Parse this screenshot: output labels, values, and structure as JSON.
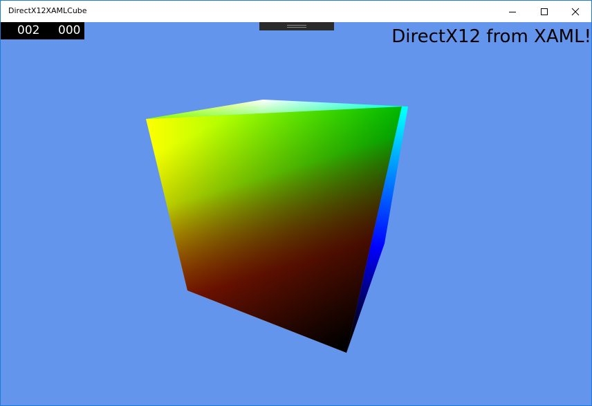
{
  "window": {
    "title": "DirectX12XAMLCube"
  },
  "caption_buttons": {
    "minimize_icon": "minimize-icon",
    "maximize_icon": "maximize-icon",
    "close_icon": "close-icon"
  },
  "content": {
    "background_color": "#6495ed",
    "counter": {
      "left_value": "002",
      "right_value": "000"
    },
    "headline": "DirectX12 from XAML!",
    "cube_colors": {
      "top": [
        "#ffff00",
        "#ffffff",
        "#00ffff",
        "#00ff00"
      ],
      "front": [
        "#ffff00",
        "#00ff00",
        "#000000",
        "#ff0000"
      ],
      "right": [
        "#00ffff",
        "#0000ff",
        "#000000",
        "#00ff00"
      ]
    }
  }
}
